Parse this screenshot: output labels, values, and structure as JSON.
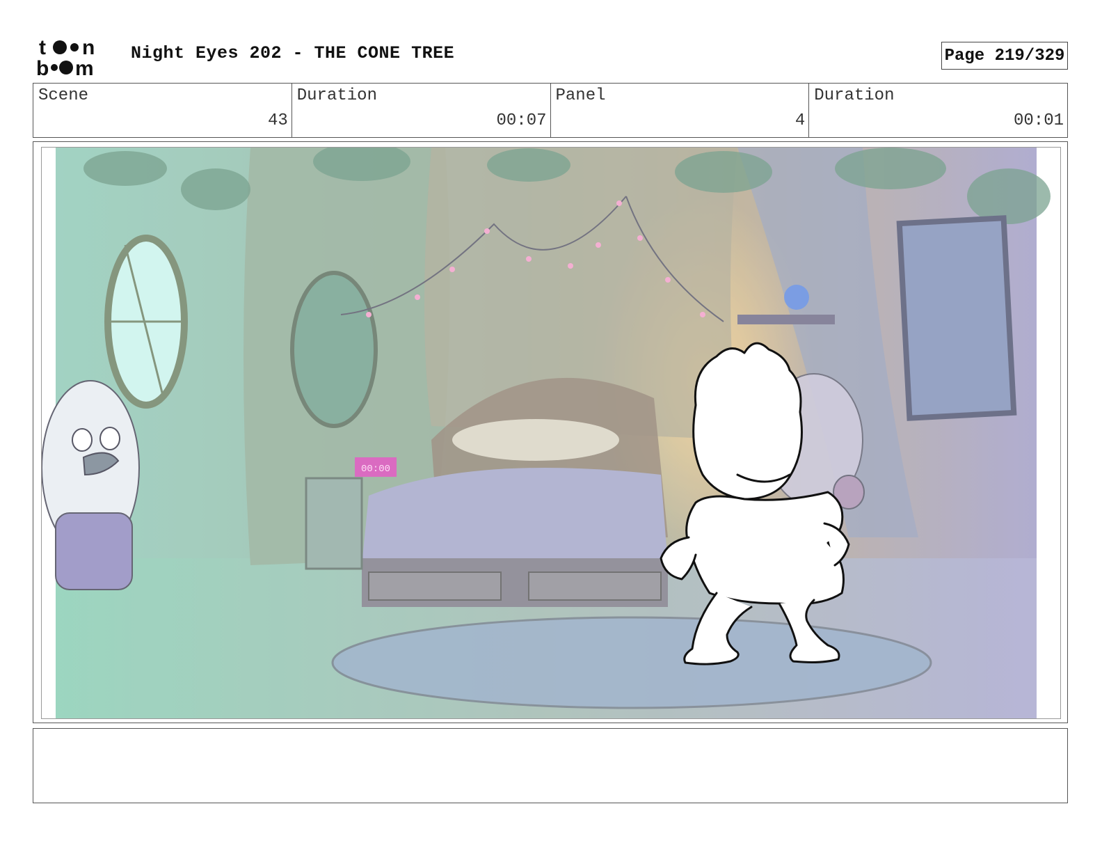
{
  "header": {
    "logo_text": "toon boom",
    "title": "Night Eyes 202 - THE CONE TREE",
    "page": "Page 219/329"
  },
  "info": {
    "scene_label": "Scene",
    "scene_value": "43",
    "duration_label": "Duration",
    "duration_value": "00:07",
    "panel_label": "Panel",
    "panel_value": "4",
    "panel_duration_label": "Duration",
    "panel_duration_value": "00:01"
  },
  "panel": {
    "clock_display": "00:00"
  },
  "notes": {
    "text": ""
  },
  "colors": {
    "border": "#555555",
    "scene_teal": "#7fc8b0",
    "scene_purple": "#9a94c4",
    "lamp_glow": "#f5c27a"
  }
}
